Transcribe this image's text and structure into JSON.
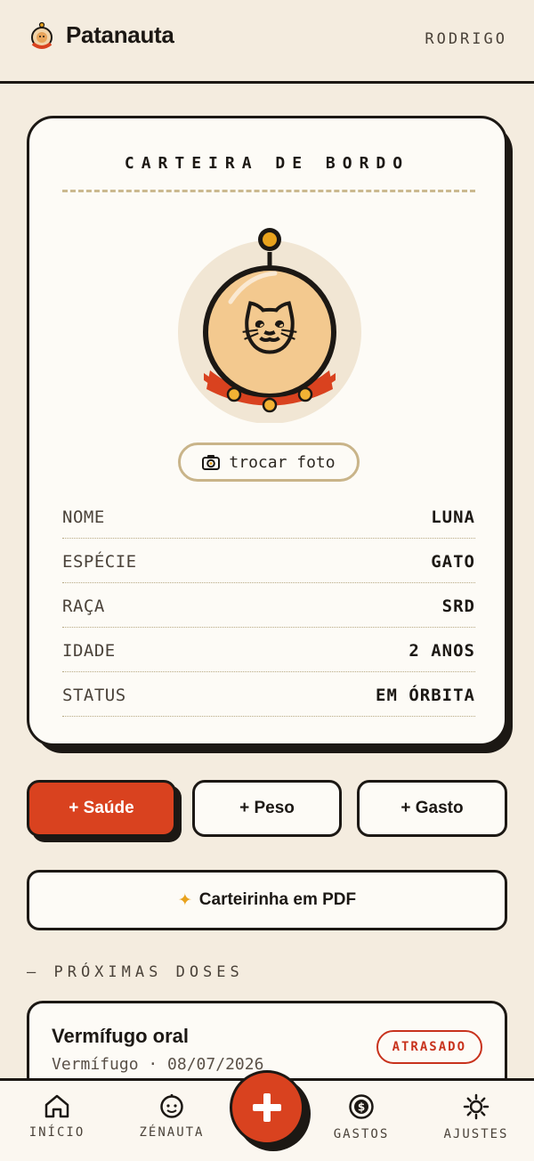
{
  "header": {
    "brand": "Patanauta",
    "user": "RODRIGO"
  },
  "card": {
    "title": "CARTEIRA DE BORDO",
    "avatar_emoji": "🐱",
    "photo_button": "trocar foto",
    "fields": [
      {
        "label": "NOME",
        "value": "LUNA"
      },
      {
        "label": "ESPÉCIE",
        "value": "GATO"
      },
      {
        "label": "RAÇA",
        "value": "SRD"
      },
      {
        "label": "IDADE",
        "value": "2 ANOS"
      },
      {
        "label": "STATUS",
        "value": "EM ÓRBITA"
      }
    ]
  },
  "actions": {
    "saude": "+ Saúde",
    "peso": "+ Peso",
    "gasto": "+ Gasto",
    "pdf_icon": "✦",
    "pdf": "Carteirinha em PDF"
  },
  "section": {
    "title": "— PRÓXIMAS DOSES"
  },
  "doses": [
    {
      "name": "Vermífugo oral",
      "subtitle": "Vermífugo · 08/07/2026",
      "badge": "ATRASADO"
    }
  ],
  "nav": {
    "inicio": "INÍCIO",
    "zenauta": "ZÉNAUTA",
    "gastos": "GASTOS",
    "ajustes": "AJUSTES"
  },
  "colors": {
    "accent": "#d9421f",
    "ink": "#1c1814",
    "background": "#f4ecdf",
    "gold": "#e8a21d"
  }
}
